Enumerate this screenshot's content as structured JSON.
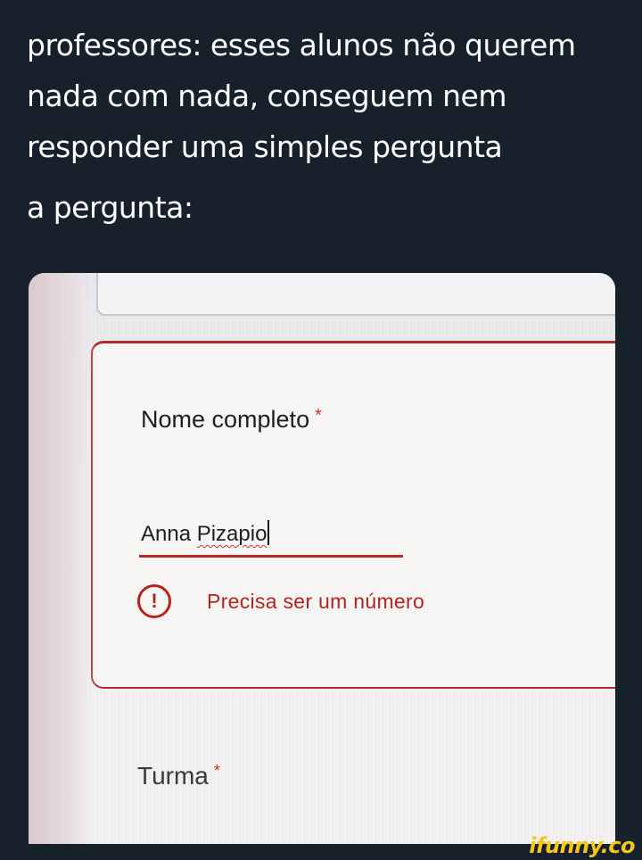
{
  "caption": {
    "lines": [
      "professores: esses alunos não querem",
      "nada com nada, conseguem nem",
      "responder uma simples pergunta"
    ],
    "second": "a pergunta:"
  },
  "form": {
    "question_title": "Nome completo",
    "required_mark": "*",
    "answer_first": "Anna ",
    "answer_last": "Pizapio",
    "error_icon": "!",
    "error_message": "Precisa ser um número",
    "next_question_title": "Turma",
    "next_required_mark": "*"
  },
  "watermark": "ifunny.co",
  "colors": {
    "background": "#17212c",
    "error": "#b4231d",
    "watermark": "#f5c518"
  }
}
